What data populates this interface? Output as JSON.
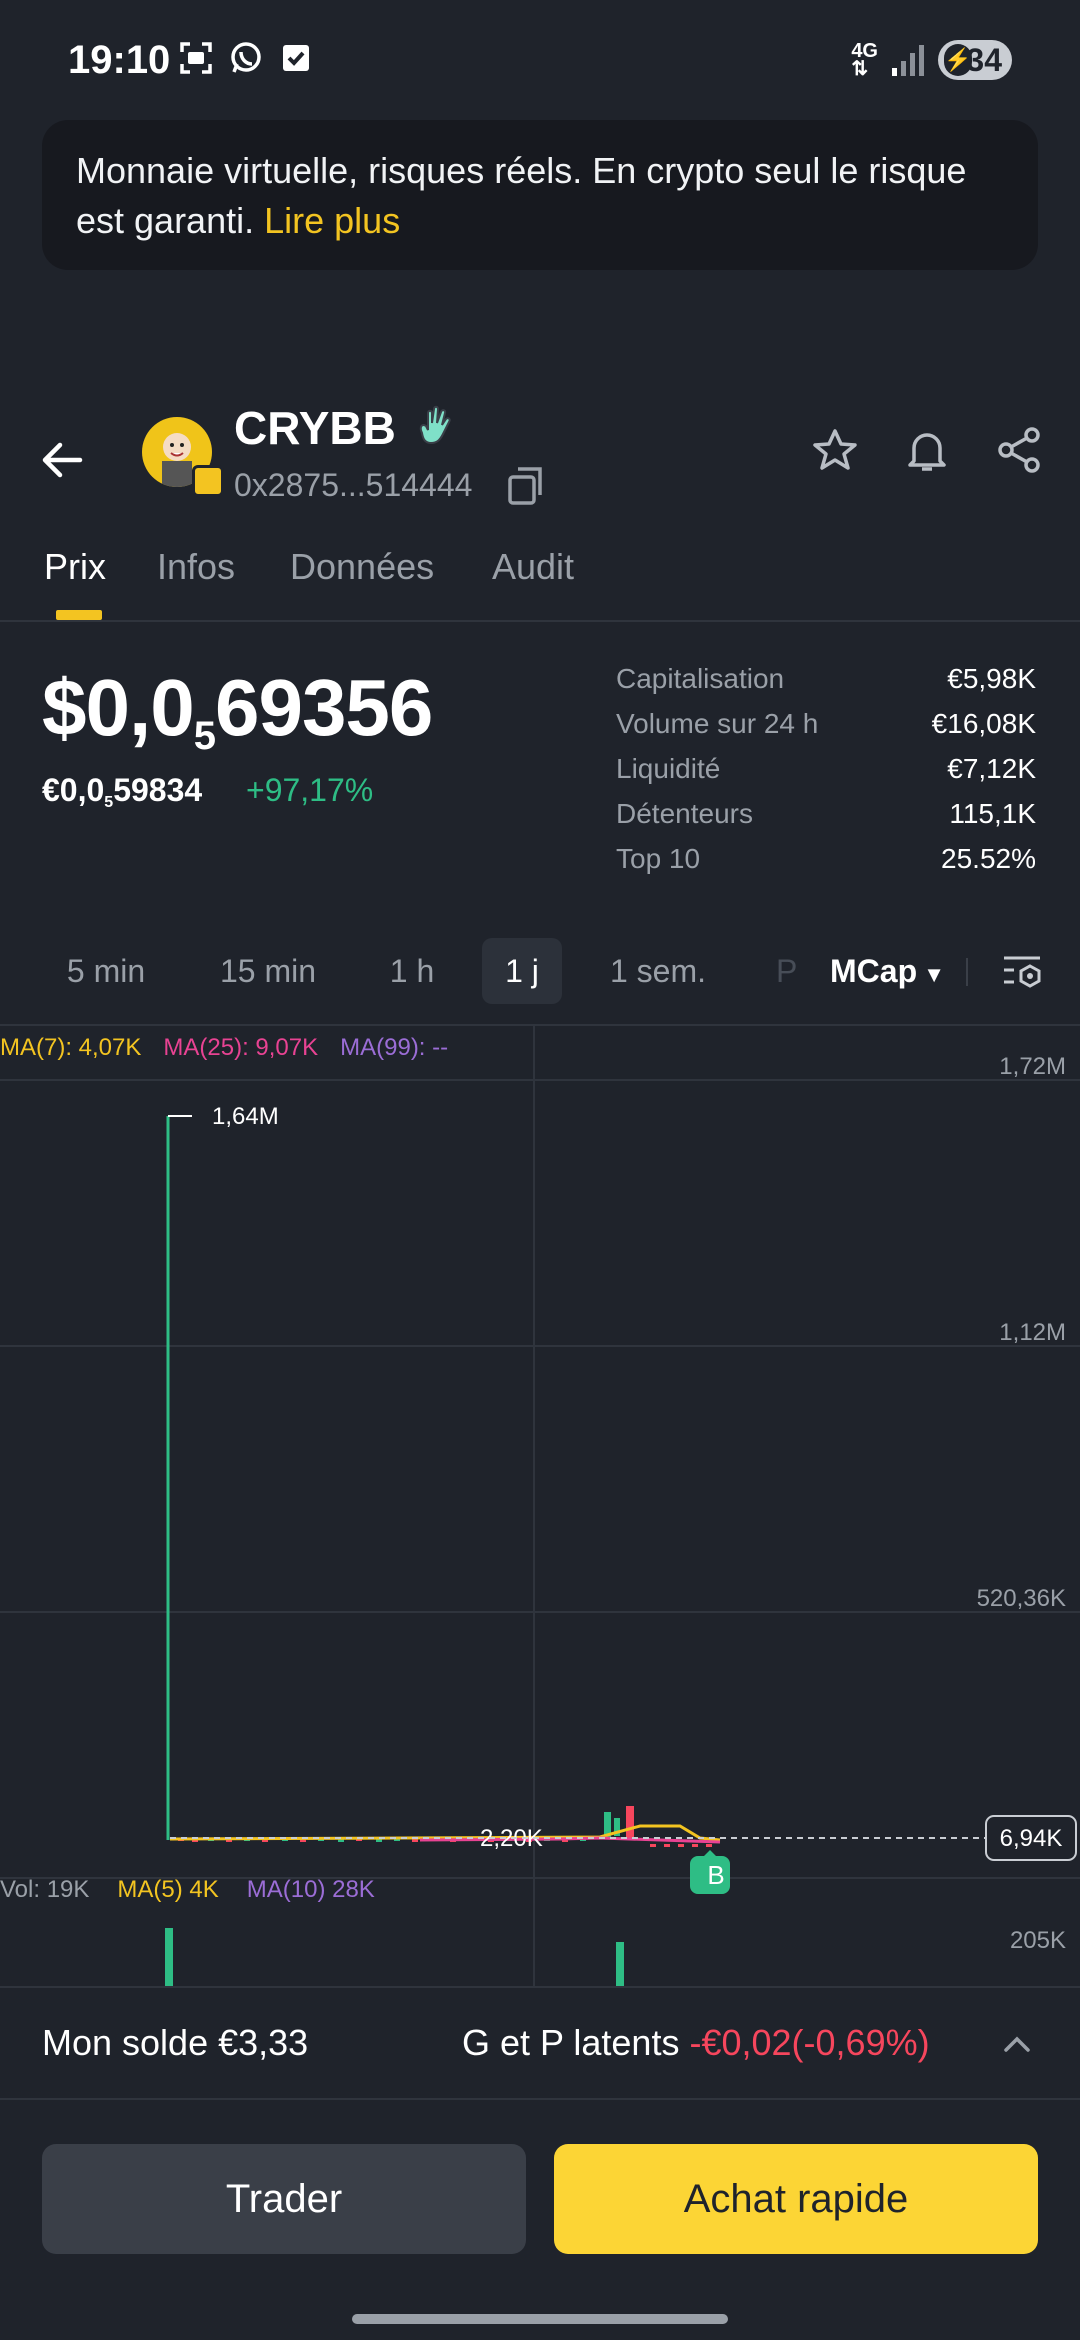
{
  "status_bar": {
    "time": "19:10",
    "network": "4G",
    "battery": "34"
  },
  "banner": {
    "text": "Monnaie virtuelle, risques réels. En crypto seul le risque est garanti.",
    "link": "Lire plus"
  },
  "token": {
    "name": "CRYBB",
    "address": "0x2875...514444"
  },
  "tabs": [
    "Prix",
    "Infos",
    "Données",
    "Audit"
  ],
  "price": {
    "main_prefix": "$0,0",
    "main_sub": "5",
    "main_suffix": "69356",
    "fiat_prefix": "€0,0",
    "fiat_sub": "5",
    "fiat_suffix": "59834",
    "change": "+97,17%"
  },
  "stats": [
    {
      "label": "Capitalisation",
      "value": "€5,98K"
    },
    {
      "label": "Volume sur 24 h",
      "value": "€16,08K"
    },
    {
      "label": "Liquidité",
      "value": "€7,12K"
    },
    {
      "label": "Détenteurs",
      "value": "115,1K"
    },
    {
      "label": "Top 10",
      "value": "25.52%"
    }
  ],
  "timeframes": [
    "5 min",
    "15 min",
    "1 h",
    "1 j",
    "1 sem."
  ],
  "timeframe_more": "P",
  "active_timeframe": "1 j",
  "mcap_label": "MCap",
  "ma_indicators": {
    "ma7": "MA(7): 4,07K",
    "ma25": "MA(25): 9,07K",
    "ma99": "MA(99): --"
  },
  "volume_indicators": {
    "vol": "Vol: 19K",
    "ma5": "MA(5) 4K",
    "ma10": "MA(10) 28K"
  },
  "chart_data": {
    "type": "candlestick",
    "y_axis_labels": [
      "1,72M",
      "1,12M",
      "520,36K"
    ],
    "max_annotation": "1,64M",
    "min_annotation": "2,20K",
    "current_value": "6,94K",
    "buy_marker": "B",
    "volume_axis_label": "205K",
    "colors": {
      "up": "#2ebd85",
      "down": "#f6465d",
      "ma7": "#f3c421",
      "ma25": "#e84393",
      "ma99": "#9b6dd6"
    }
  },
  "bottom": {
    "balance": "Mon solde €3,33",
    "pnl_label": "G et P latents",
    "pnl_value": "-€0,02(-0,69%)"
  },
  "buttons": {
    "trade": "Trader",
    "buy": "Achat rapide"
  }
}
